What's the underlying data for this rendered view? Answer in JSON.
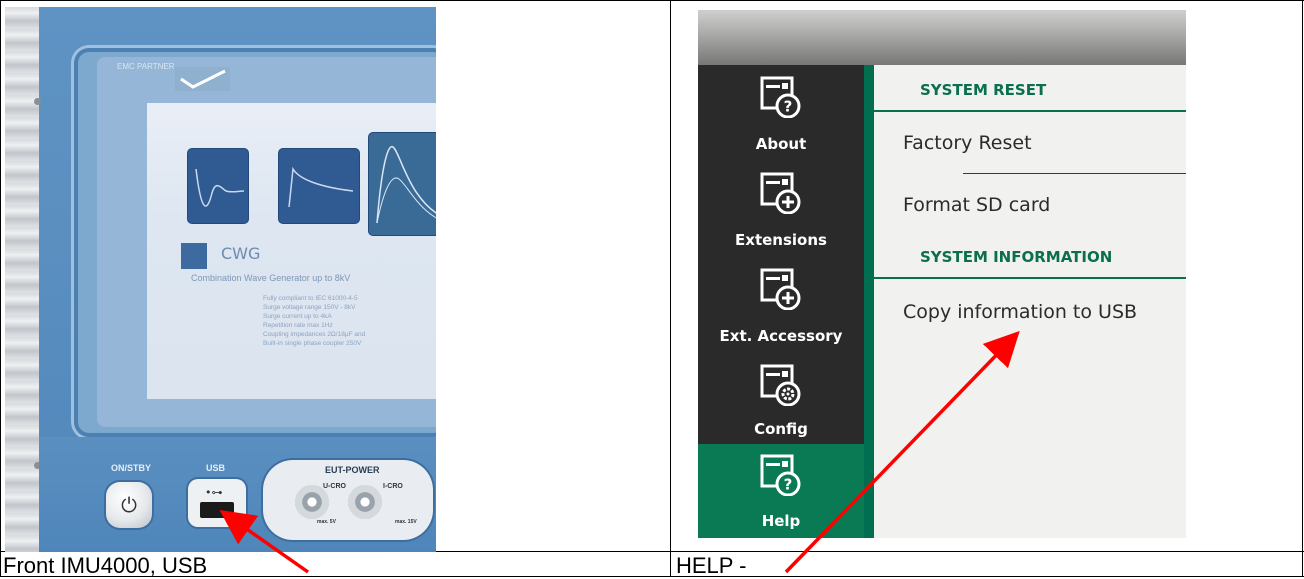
{
  "captions": {
    "left": "Front IMU4000, USB",
    "right": "HELP -"
  },
  "photo": {
    "brand_logo": "EMC PARTNER",
    "screen": {
      "module_name": "CWG",
      "module_description": "Combination Wave Generator up to 8kV",
      "features": [
        "Fully compliant to IEC 61000-4-5",
        "Surge voltage range 150V - 8kV",
        "Surge current up to 4kA",
        "Repetition rate max 1Hz",
        "Coupling impedances 2Ω/18µF and",
        "Built-in single phase coupler 250V"
      ]
    },
    "controls": {
      "power_label": "ON/STBY",
      "power_symbol": "⏻",
      "usb_label": "USB",
      "usb_symbol": "•⊶",
      "eut_label": "EUT-POWER",
      "u_cro_label": "U-CRO",
      "i_cro_label": "I-CRO",
      "u_cro_max": "max. 5V",
      "i_cro_max": "max. 15V"
    }
  },
  "app": {
    "sidebar": {
      "items": [
        {
          "label": "About",
          "icon": "question-icon",
          "active": false
        },
        {
          "label": "Extensions",
          "icon": "plus-icon",
          "active": false
        },
        {
          "label": "Ext. Accessory",
          "icon": "plus-icon",
          "active": false
        },
        {
          "label": "Config",
          "icon": "gear-icon",
          "active": false
        },
        {
          "label": "Help",
          "icon": "question-icon",
          "active": true
        }
      ]
    },
    "sections": [
      {
        "header": "SYSTEM RESET",
        "items": [
          "Factory Reset",
          "Format SD card"
        ]
      },
      {
        "header": "SYSTEM INFORMATION",
        "items": [
          "Copy information to USB"
        ]
      }
    ],
    "colors": {
      "accent": "#0b6e4f",
      "sidebar_bg": "#2a2a2a",
      "active_bg": "#0a7a55",
      "content_bg": "#f1f1ef"
    }
  },
  "annotation_color": "#ff0000"
}
